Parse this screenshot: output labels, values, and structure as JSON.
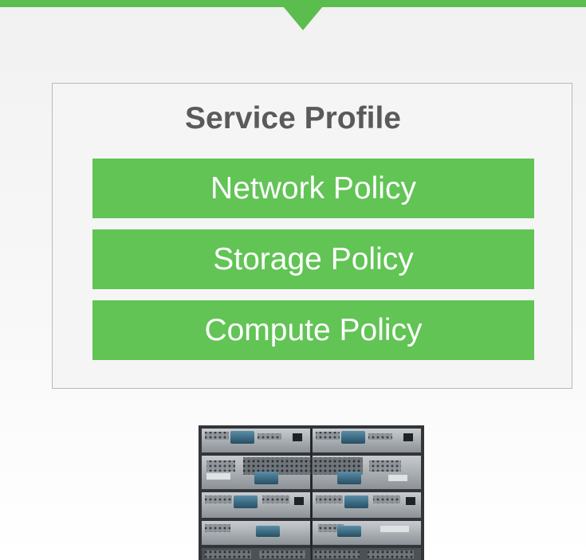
{
  "diagram": {
    "title": "Service Profile",
    "policies": [
      {
        "label": "Network Policy"
      },
      {
        "label": "Storage Policy"
      },
      {
        "label": "Compute Policy"
      }
    ],
    "image_subject": "blade-server-chassis"
  },
  "colors": {
    "accent": "#5cbd4f",
    "policy_fill": "#61c455",
    "title_text": "#5a5a5a",
    "border": "#b9b9b9"
  }
}
